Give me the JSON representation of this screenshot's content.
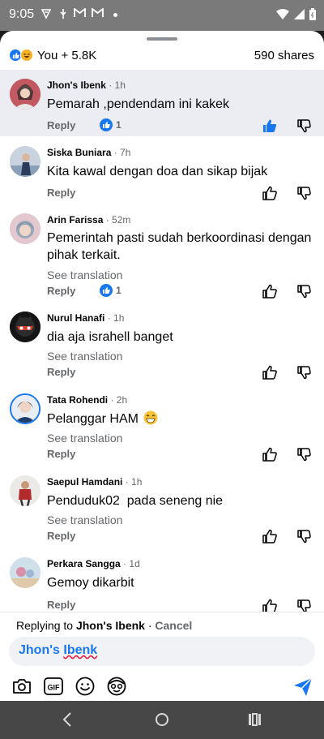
{
  "status_bar": {
    "time": "9:05"
  },
  "summary": {
    "reactions_text": "You + 5.8K",
    "shares": "590 shares"
  },
  "comments": [
    {
      "name": "Jhon's Ibenk",
      "time": "1h",
      "text": "Pemarah ,pendendam ini kakek",
      "reply": "Reply",
      "likes": "1",
      "liked": true
    },
    {
      "name": "Siska Buniara",
      "time": "7h",
      "text": "Kita kawal dengan doa dan sikap bijak",
      "reply": "Reply"
    },
    {
      "name": "Arin Farissa",
      "time": "52m",
      "text": "Pemerintah pasti sudah berkoordinasi dengan pihak terkait.",
      "see_translation": "See translation",
      "reply": "Reply",
      "likes": "1"
    },
    {
      "name": "Nurul Hanafi",
      "time": "1h",
      "text": "dia aja israhell banget",
      "see_translation": "See translation",
      "reply": "Reply"
    },
    {
      "name": "Tata Rohendi",
      "time": "2h",
      "text": "Pelanggar HAM",
      "see_translation": "See translation",
      "reply": "Reply"
    },
    {
      "name": "Saepul Hamdani",
      "time": "1h",
      "text": "Penduduk02  pada seneng nie",
      "see_translation": "See translation",
      "reply": "Reply"
    },
    {
      "name": "Perkara Sangga",
      "time": "1d",
      "text": "Gemoy dikarbit",
      "reply": "Reply"
    }
  ],
  "reply_bar": {
    "replying_prefix": "Replying to ",
    "replying_to": "Jhon's Ibenk",
    "separator": " · ",
    "cancel": "Cancel",
    "input_first": "Jhon's ",
    "input_second": "Ibenk"
  },
  "icons": {
    "like": "thumbs-up-icon",
    "dislike": "thumbs-down-icon",
    "camera": "camera-icon",
    "gif": "gif-icon",
    "emoji": "smiley-icon",
    "avatar_sticker": "avatar-sticker-icon",
    "send": "send-icon"
  },
  "colors": {
    "accent": "#1877f2",
    "muted": "#65676b",
    "highlight": "#ecedf3"
  }
}
